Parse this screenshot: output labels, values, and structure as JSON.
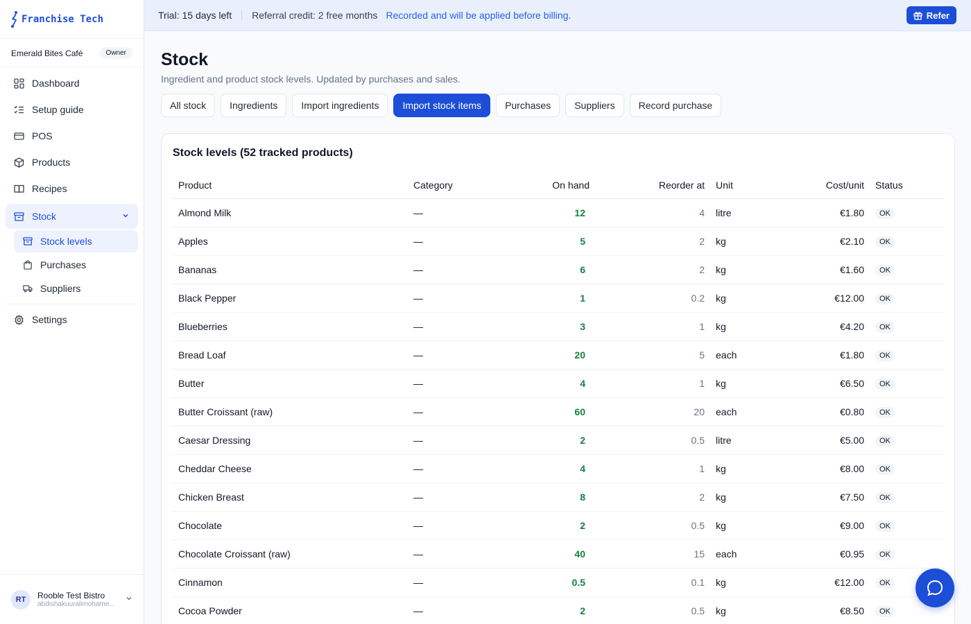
{
  "brand": {
    "name": "Franchise Tech"
  },
  "org": {
    "name": "Emerald Bites Café",
    "role": "Owner"
  },
  "nav": {
    "dashboard": "Dashboard",
    "setup_guide": "Setup guide",
    "pos": "POS",
    "products": "Products",
    "recipes": "Recipes",
    "stock": "Stock",
    "stock_levels": "Stock levels",
    "purchases": "Purchases",
    "suppliers": "Suppliers",
    "settings": "Settings"
  },
  "user": {
    "initials": "RT",
    "name": "Rooble Test Bistro",
    "email": "abdishakuuralimohame..."
  },
  "banner": {
    "trial": "Trial: 15 days left",
    "referral": "Referral credit: 2 free months",
    "recorded": "Recorded and will be applied before billing.",
    "refer_button": "Refer"
  },
  "page": {
    "title": "Stock",
    "subtitle": "Ingredient and product stock levels. Updated by purchases and sales."
  },
  "tabs": [
    {
      "label": "All stock",
      "active": false
    },
    {
      "label": "Ingredients",
      "active": false
    },
    {
      "label": "Import ingredients",
      "active": false
    },
    {
      "label": "Import stock items",
      "active": true
    },
    {
      "label": "Purchases",
      "active": false
    },
    {
      "label": "Suppliers",
      "active": false
    },
    {
      "label": "Record purchase",
      "active": false
    }
  ],
  "table": {
    "title": "Stock levels (52 tracked products)",
    "columns": {
      "product": "Product",
      "category": "Category",
      "on_hand": "On hand",
      "reorder_at": "Reorder at",
      "unit": "Unit",
      "cost_unit": "Cost/unit",
      "status": "Status"
    },
    "rows": [
      {
        "product": "Almond Milk",
        "category": "—",
        "on_hand": "12",
        "reorder_at": "4",
        "unit": "litre",
        "cost": "€1.80",
        "status": "OK"
      },
      {
        "product": "Apples",
        "category": "—",
        "on_hand": "5",
        "reorder_at": "2",
        "unit": "kg",
        "cost": "€2.10",
        "status": "OK"
      },
      {
        "product": "Bananas",
        "category": "—",
        "on_hand": "6",
        "reorder_at": "2",
        "unit": "kg",
        "cost": "€1.60",
        "status": "OK"
      },
      {
        "product": "Black Pepper",
        "category": "—",
        "on_hand": "1",
        "reorder_at": "0.2",
        "unit": "kg",
        "cost": "€12.00",
        "status": "OK"
      },
      {
        "product": "Blueberries",
        "category": "—",
        "on_hand": "3",
        "reorder_at": "1",
        "unit": "kg",
        "cost": "€4.20",
        "status": "OK"
      },
      {
        "product": "Bread Loaf",
        "category": "—",
        "on_hand": "20",
        "reorder_at": "5",
        "unit": "each",
        "cost": "€1.80",
        "status": "OK"
      },
      {
        "product": "Butter",
        "category": "—",
        "on_hand": "4",
        "reorder_at": "1",
        "unit": "kg",
        "cost": "€6.50",
        "status": "OK"
      },
      {
        "product": "Butter Croissant (raw)",
        "category": "—",
        "on_hand": "60",
        "reorder_at": "20",
        "unit": "each",
        "cost": "€0.80",
        "status": "OK"
      },
      {
        "product": "Caesar Dressing",
        "category": "—",
        "on_hand": "2",
        "reorder_at": "0.5",
        "unit": "litre",
        "cost": "€5.00",
        "status": "OK"
      },
      {
        "product": "Cheddar Cheese",
        "category": "—",
        "on_hand": "4",
        "reorder_at": "1",
        "unit": "kg",
        "cost": "€8.00",
        "status": "OK"
      },
      {
        "product": "Chicken Breast",
        "category": "—",
        "on_hand": "8",
        "reorder_at": "2",
        "unit": "kg",
        "cost": "€7.50",
        "status": "OK"
      },
      {
        "product": "Chocolate",
        "category": "—",
        "on_hand": "2",
        "reorder_at": "0.5",
        "unit": "kg",
        "cost": "€9.00",
        "status": "OK"
      },
      {
        "product": "Chocolate Croissant (raw)",
        "category": "—",
        "on_hand": "40",
        "reorder_at": "15",
        "unit": "each",
        "cost": "€0.95",
        "status": "OK"
      },
      {
        "product": "Cinnamon",
        "category": "—",
        "on_hand": "0.5",
        "reorder_at": "0.1",
        "unit": "kg",
        "cost": "€12.00",
        "status": "OK"
      },
      {
        "product": "Cocoa Powder",
        "category": "—",
        "on_hand": "2",
        "reorder_at": "0.5",
        "unit": "kg",
        "cost": "€8.50",
        "status": "OK"
      }
    ]
  },
  "colors": {
    "accent": "#1d4ed8",
    "on_hand": "#15803d",
    "banner_bg": "#eaf0fb"
  },
  "icons": [
    "logo-icon",
    "dashboard-icon",
    "checklist-icon",
    "card-icon",
    "box-icon",
    "book-icon",
    "archive-icon",
    "chevron-down-icon",
    "bag-icon",
    "truck-icon",
    "gear-icon",
    "gift-icon",
    "chat-icon"
  ]
}
